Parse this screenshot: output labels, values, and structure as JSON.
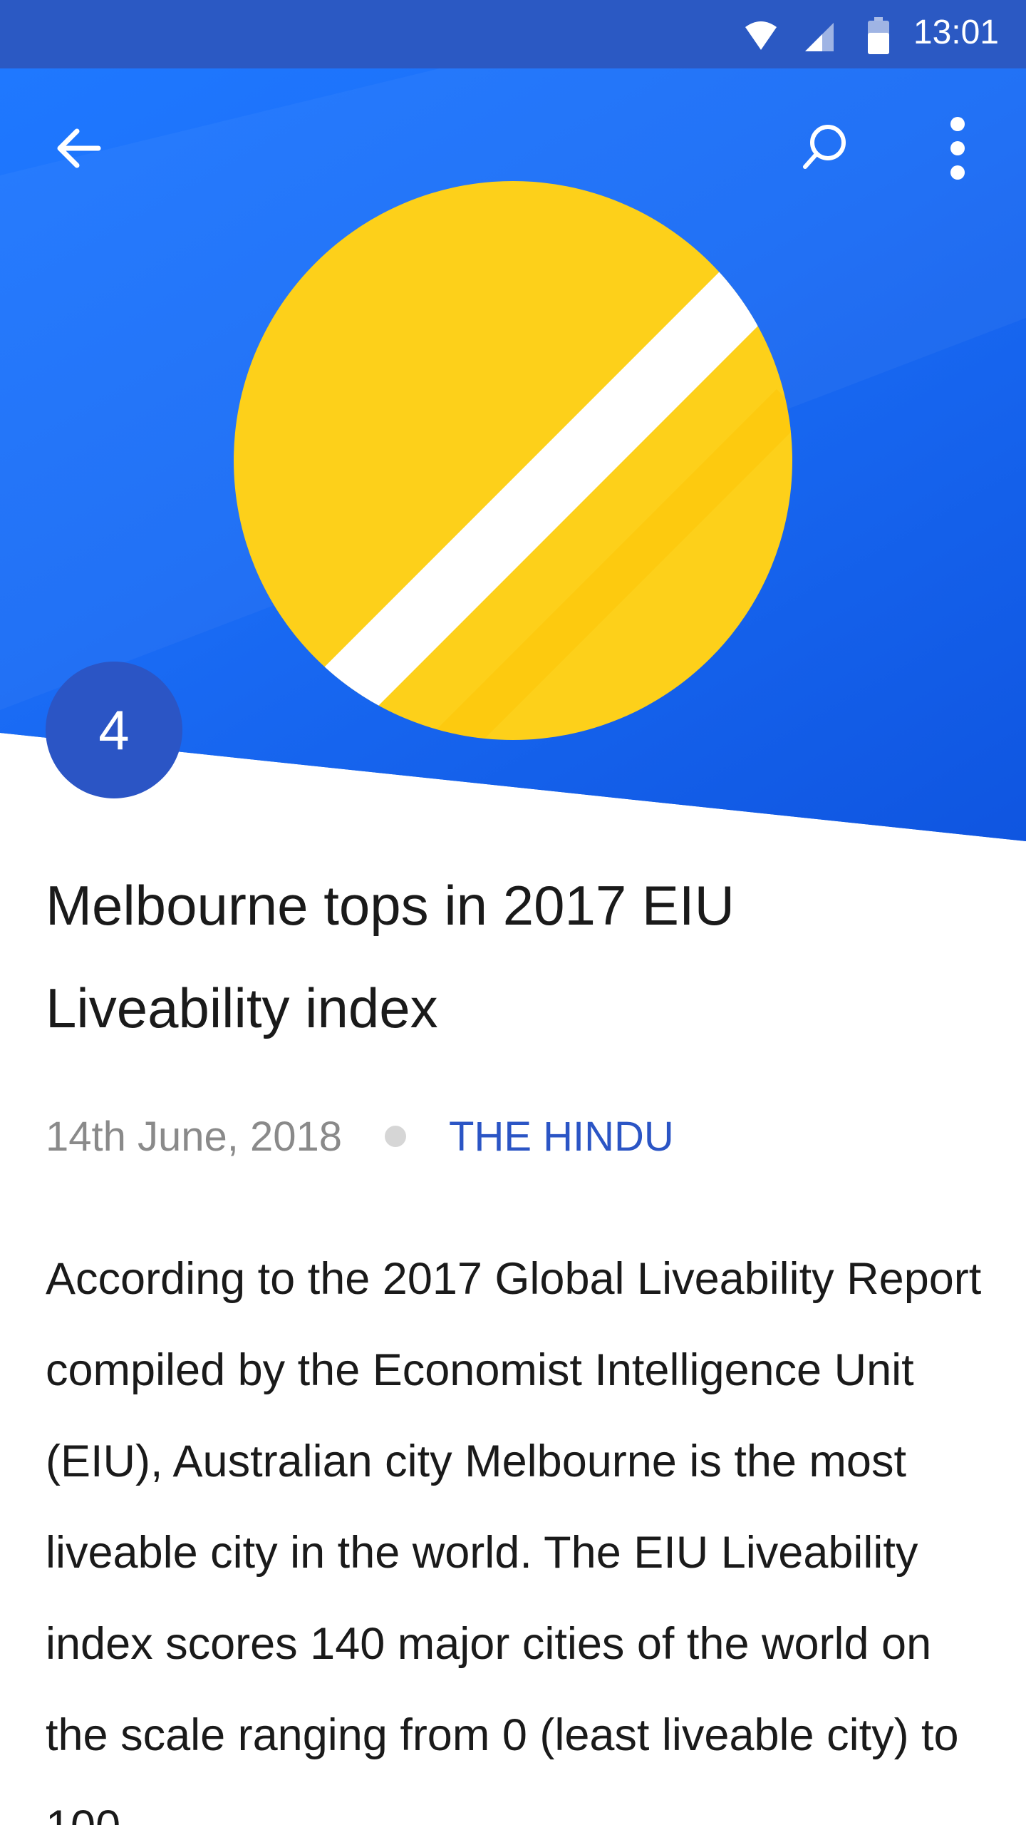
{
  "status_bar": {
    "time": "13:01",
    "background": "#2b59c3",
    "icons": [
      "wifi-icon",
      "cell-signal-icon",
      "battery-icon"
    ]
  },
  "app_bar": {
    "back_icon": "arrow-back-icon",
    "search_icon": "search-icon",
    "more_icon": "more-vertical-icon"
  },
  "hero": {
    "background": "#1565e8",
    "illustration": "yellow circle with white diagonal stripe",
    "circle_color": "#fdd01a",
    "stripe_color": "#ffffff"
  },
  "article": {
    "rank": "4",
    "rank_color": "#2b55c5",
    "title": "Melbourne tops in 2017 EIU Liveability index",
    "date": "14th June, 2018",
    "source": "THE HINDU",
    "source_color": "#2b55c5",
    "body": "According to the 2017 Global Liveability Report compiled by the Economist Intelligence Unit (EIU), Australian city Melbourne is the most liveable city in the world. The EIU Liveability index scores 140 major cities of the world on the scale ranging from 0 (least liveable city) to 100"
  }
}
